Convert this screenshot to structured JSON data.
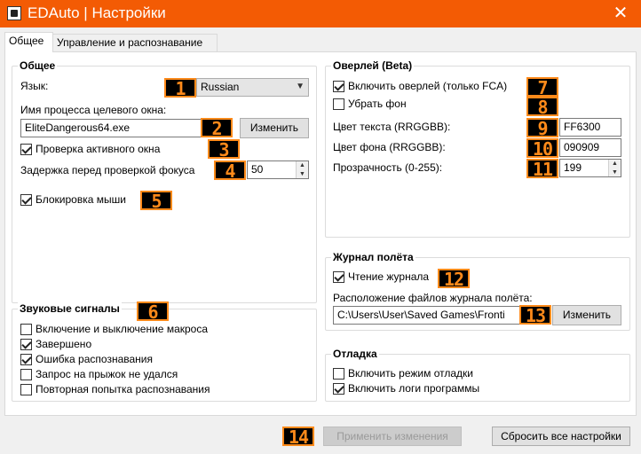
{
  "window": {
    "title": "EDAuto | Настройки",
    "close_glyph": "✕"
  },
  "tabs": [
    "Общее",
    "Управление и распознавание"
  ],
  "general": {
    "legend": "Общее",
    "language_label": "Язык:",
    "language_value": "Russian",
    "process_label": "Имя процесса целевого окна:",
    "process_value": "EliteDangerous64.exe",
    "change_label": "Изменить",
    "active_window_label": "Проверка активного окна",
    "active_window_checked": true,
    "focus_delay_label": "Задержка перед проверкой фокуса",
    "focus_delay_value": "50",
    "mouse_lock_label": "Блокировка мыши",
    "mouse_lock_checked": true
  },
  "sounds": {
    "legend": "Звуковые сигналы",
    "items": [
      {
        "label": "Включение и выключение макроса",
        "checked": false
      },
      {
        "label": "Завершено",
        "checked": true
      },
      {
        "label": "Ошибка распознавания",
        "checked": true
      },
      {
        "label": "Запрос на прыжок не удался",
        "checked": false
      },
      {
        "label": "Повторная попытка распознавания",
        "checked": false
      }
    ]
  },
  "overlay": {
    "legend": "Оверлей (Beta)",
    "enable_label": "Включить оверлей (только FCA)",
    "enable_checked": true,
    "hide_bg_label": "Убрать фон",
    "hide_bg_checked": false,
    "text_color_label": "Цвет текста (RRGGBB):",
    "text_color_value": "FF6300",
    "bg_color_label": "Цвет фона (RRGGBB):",
    "bg_color_value": "090909",
    "opacity_label": "Прозрачность (0-255):",
    "opacity_value": "199"
  },
  "journal": {
    "legend": "Журнал полёта",
    "read_label": "Чтение журнала",
    "read_checked": true,
    "location_label": "Расположение файлов журнала полёта:",
    "location_value": "C:\\Users\\User\\Saved Games\\Fronti",
    "change_label": "Изменить"
  },
  "debug": {
    "legend": "Отладка",
    "debug_mode_label": "Включить режим отладки",
    "debug_mode_checked": false,
    "logs_label": "Включить логи программы",
    "logs_checked": true
  },
  "footer": {
    "apply_label": "Применить изменения",
    "reset_label": "Сбросить все настройки"
  },
  "markers": [
    "1",
    "2",
    "3",
    "4",
    "5",
    "6",
    "7",
    "8",
    "9",
    "10",
    "11",
    "12",
    "13",
    "14"
  ],
  "colors": {
    "title_bar": "#f35b04",
    "marker_text": "#ff8a1a",
    "marker_bg": "#000000"
  }
}
